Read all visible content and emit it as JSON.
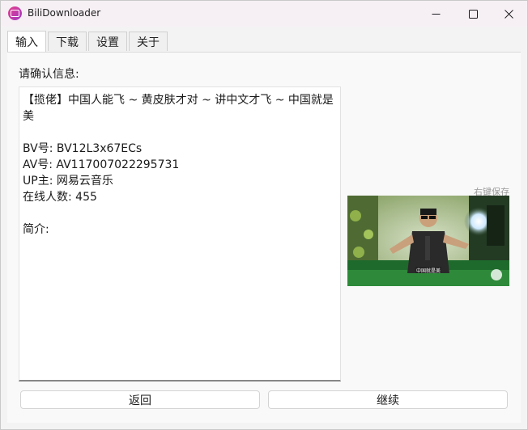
{
  "window": {
    "title": "BiliDownloader"
  },
  "tabs": [
    {
      "label": "输入",
      "active": true
    },
    {
      "label": "下载",
      "active": false
    },
    {
      "label": "设置",
      "active": false
    },
    {
      "label": "关于",
      "active": false
    }
  ],
  "panel": {
    "confirm_label": "请确认信息:",
    "video_title": "【揽佬】中国人能飞 ~ 黄皮肤才对 ~ 讲中文才飞 ~ 中国就是美",
    "bv": "BV号: BV12L3x67ECs",
    "av": "AV号: AV117007022295731",
    "uploader": "UP主: 网易云音乐",
    "online": "在线人数: 455",
    "intro_label": "简介:",
    "save_hint": "右键保存",
    "cover_caption": "中国就是美"
  },
  "buttons": {
    "back": "返回",
    "next": "继续"
  },
  "colors": {
    "titlebar": "#f6f0f5",
    "panel": "#f9f9f9",
    "app_icon": "#e33c8a"
  }
}
